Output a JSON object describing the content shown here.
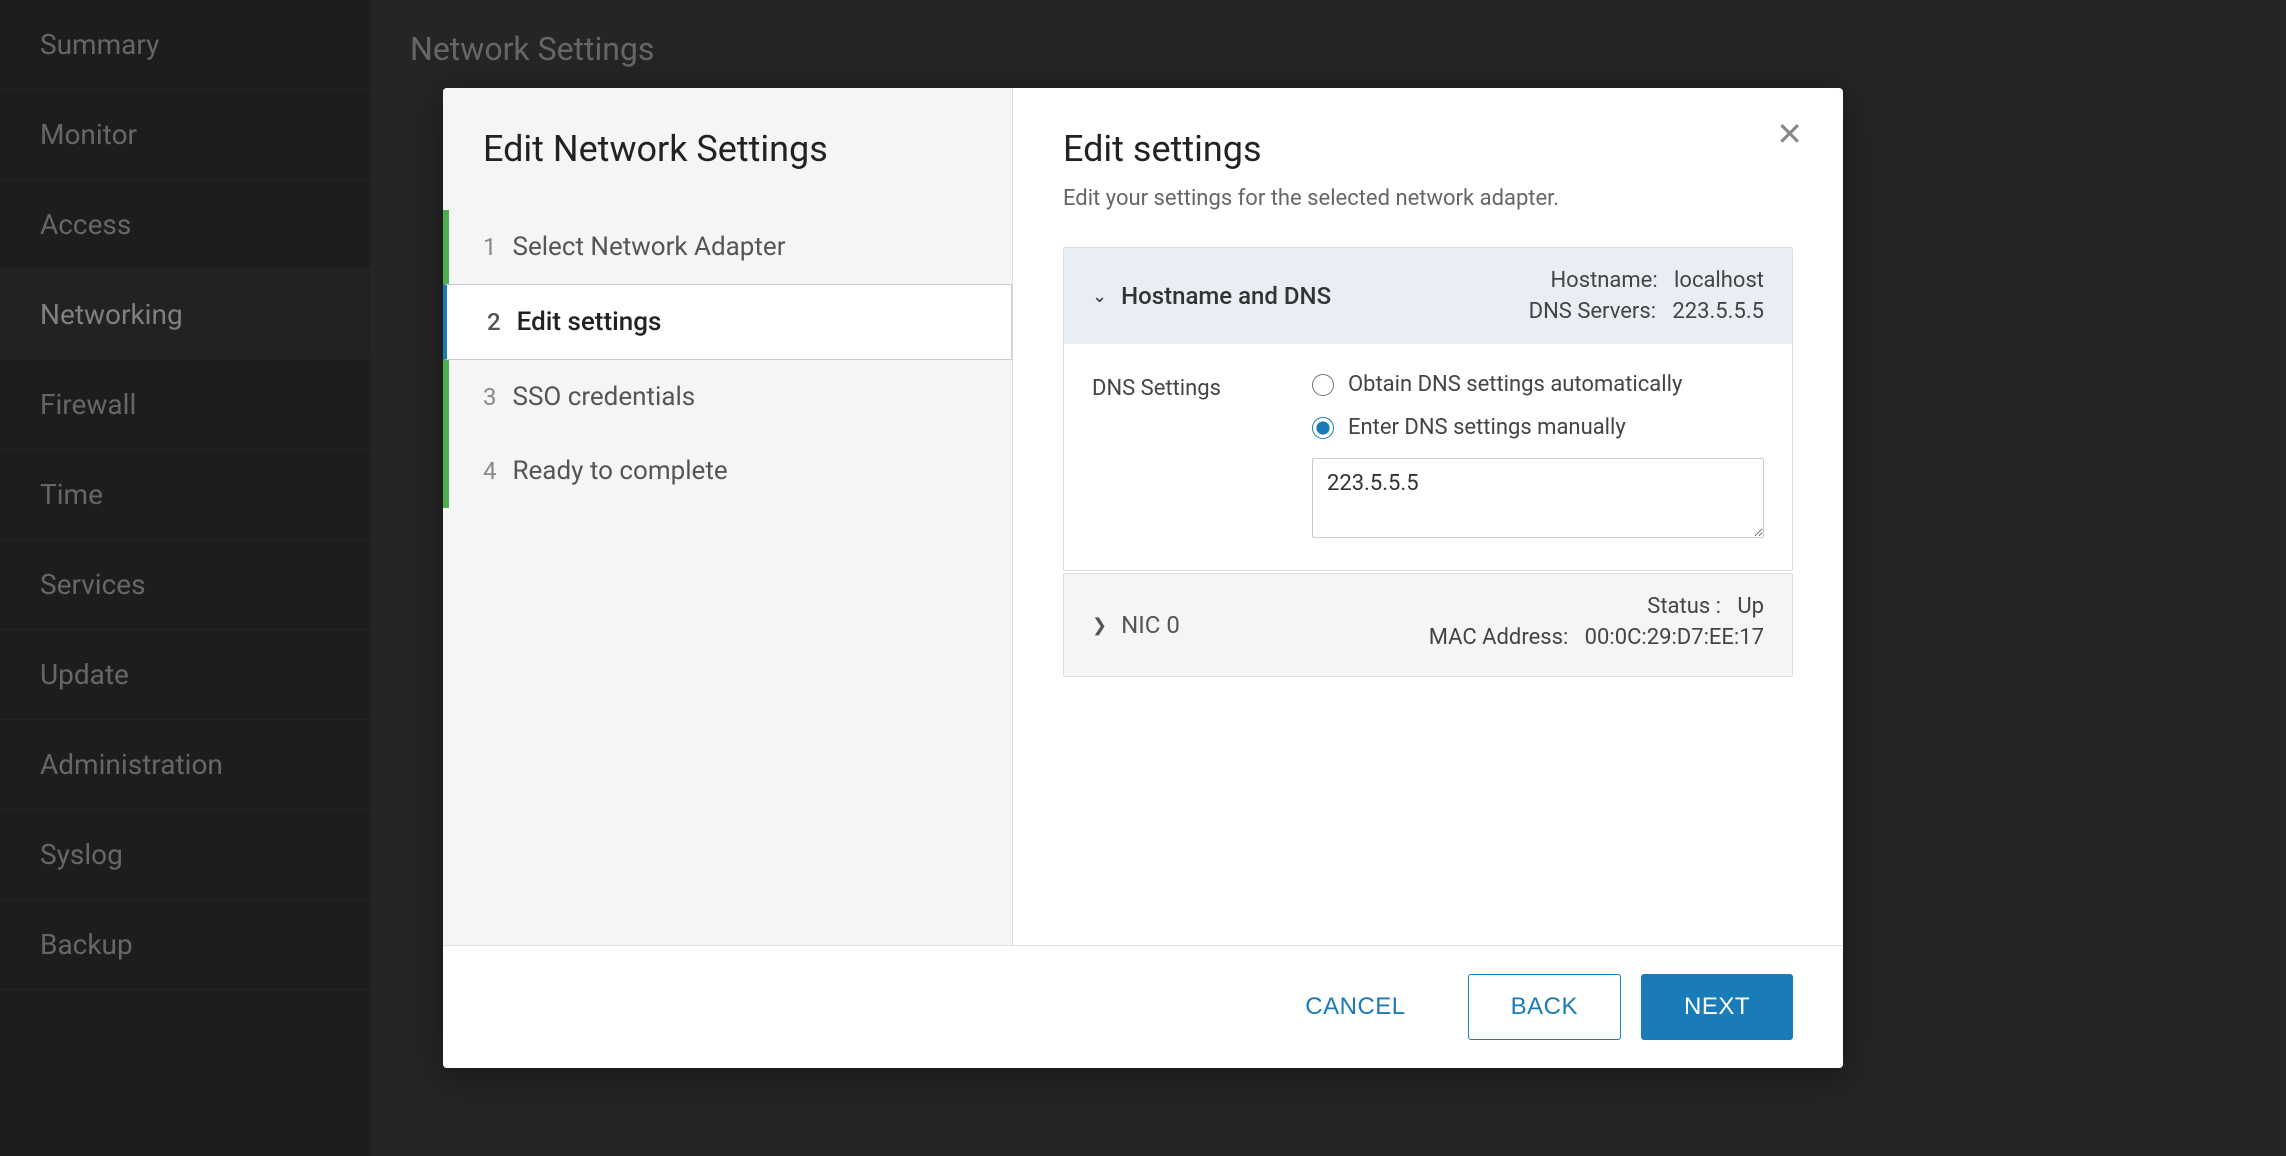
{
  "sidebar": {
    "items": [
      {
        "label": "Summary",
        "active": false
      },
      {
        "label": "Monitor",
        "active": false
      },
      {
        "label": "Access",
        "active": false
      },
      {
        "label": "Networking",
        "active": true
      },
      {
        "label": "Firewall",
        "active": false
      },
      {
        "label": "Time",
        "active": false
      },
      {
        "label": "Services",
        "active": false
      },
      {
        "label": "Update",
        "active": false
      },
      {
        "label": "Administration",
        "active": false
      },
      {
        "label": "Syslog",
        "active": false
      },
      {
        "label": "Backup",
        "active": false
      }
    ]
  },
  "bg_title": "Network Settings",
  "modal": {
    "wizard_title": "Edit Network Settings",
    "steps": [
      {
        "num": "1",
        "label": "Select Network Adapter",
        "active": false,
        "has_green_bar": true
      },
      {
        "num": "2",
        "label": "Edit settings",
        "active": true,
        "has_green_bar": false
      },
      {
        "num": "3",
        "label": "SSO credentials",
        "active": false,
        "has_green_bar": false
      },
      {
        "num": "4",
        "label": "Ready to complete",
        "active": false,
        "has_green_bar": false
      }
    ],
    "content": {
      "title": "Edit settings",
      "subtitle": "Edit your settings for the selected network adapter.",
      "hostname_section": {
        "header_label": "Hostname and DNS",
        "hostname_label": "Hostname:",
        "hostname_value": "localhost",
        "dns_servers_label": "DNS Servers:",
        "dns_servers_value": "223.5.5.5"
      },
      "dns_settings": {
        "section_label": "DNS Settings",
        "option_auto": "Obtain DNS settings automatically",
        "option_manual": "Enter DNS settings manually",
        "manual_value": "223.5.5.5"
      },
      "nic_section": {
        "label": "NIC 0",
        "status_label": "Status :",
        "status_value": "Up",
        "mac_label": "MAC Address:",
        "mac_value": "00:0C:29:D7:EE:17"
      }
    },
    "footer": {
      "cancel_label": "CANCEL",
      "back_label": "BACK",
      "next_label": "NEXT"
    }
  }
}
